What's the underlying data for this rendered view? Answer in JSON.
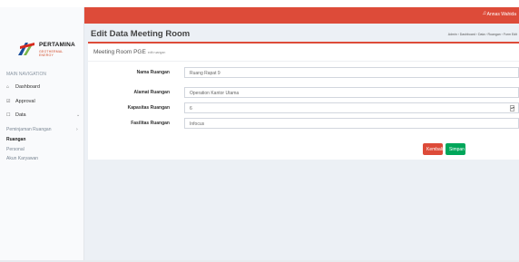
{
  "brand": {
    "name": "PERTAMINA",
    "subtitle": "GEOTHERMAL ENERGY"
  },
  "sidebar": {
    "header": "MAIN NAVIGATION",
    "items": [
      {
        "label": "Dashboard",
        "icon": "home-icon"
      },
      {
        "label": "Approval",
        "icon": "check-icon"
      },
      {
        "label": "Data",
        "icon": "list-icon"
      }
    ],
    "data_sub": [
      {
        "label": "Peminjaman Ruangan"
      },
      {
        "label": "Ruangan"
      },
      {
        "label": "Personal"
      },
      {
        "label": "Akun Karyawan"
      }
    ]
  },
  "topbar": {
    "user": "Annas Wahida"
  },
  "page": {
    "title": "Edit Data Meeting Room",
    "breadcrumb": "Admin › Dashboard › Data › Ruangan › Form Edit"
  },
  "card": {
    "title": "Meeting Room PGE",
    "title_small": "edit ruangan"
  },
  "form": {
    "fields": [
      {
        "label": "Nama Ruangan",
        "value": "Ruang Rapat 9"
      },
      {
        "label": "Alamat Ruangan",
        "value": "Operation Kantor Utama"
      },
      {
        "label": "Kapasitas Ruangan",
        "value": "6"
      },
      {
        "label": "Fasilitas Ruangan",
        "value": "Infocus"
      }
    ],
    "back_label": "Kembali",
    "save_label": "Simpan"
  },
  "colors": {
    "accent": "#dd4b39",
    "save": "#00a65a"
  }
}
